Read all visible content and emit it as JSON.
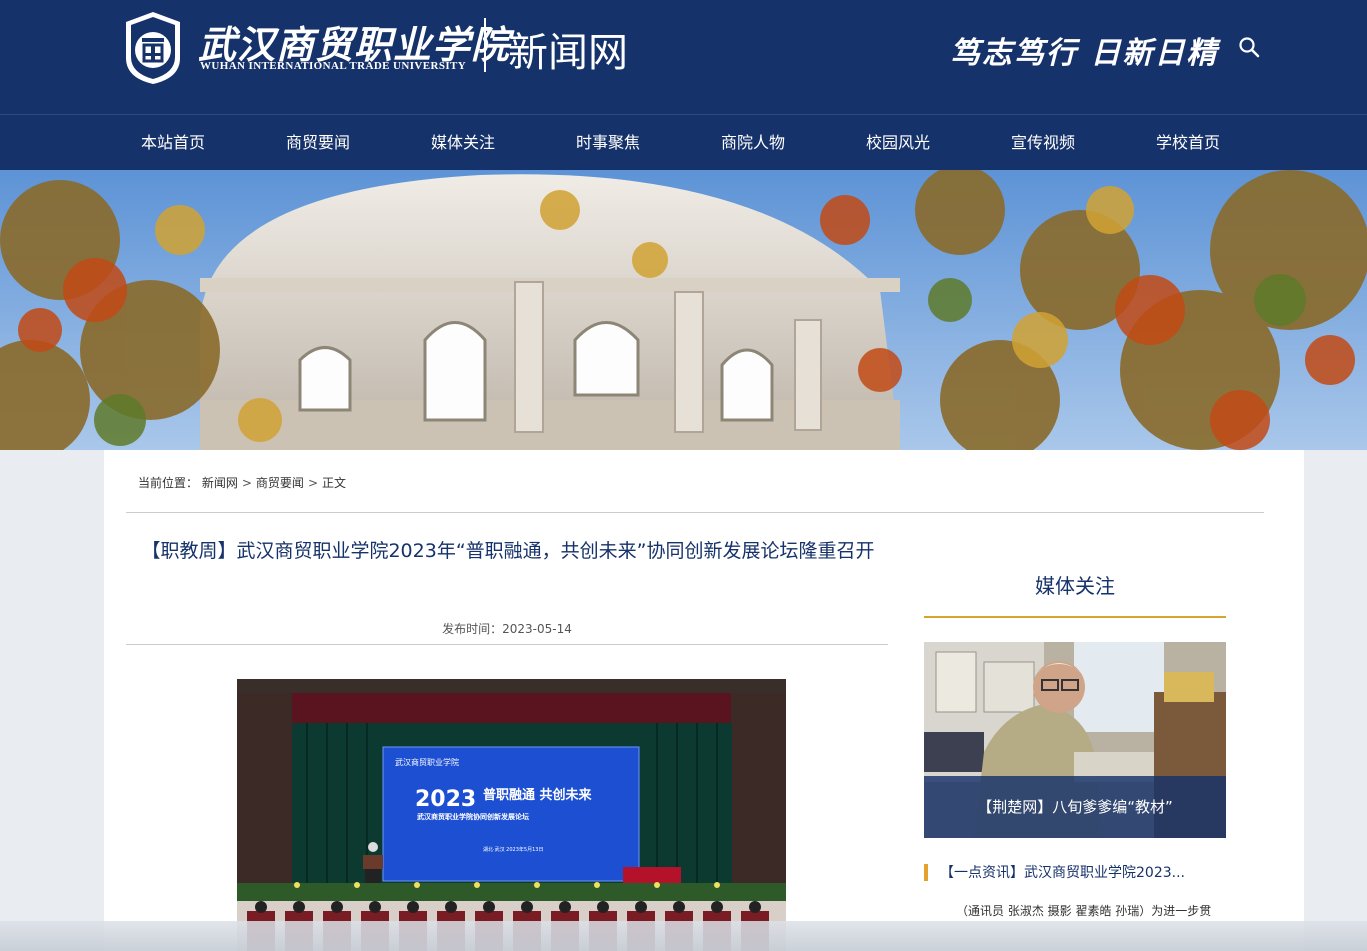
{
  "header": {
    "school_name_cn": "武汉商贸职业学院",
    "school_name_en": "WUHAN INTERNATIONAL TRADE UNIVERSITY",
    "site_name": "新闻网",
    "motto": "笃志笃行 日新日精",
    "search_icon": "search-icon",
    "brand_color": "#16326a"
  },
  "nav": {
    "items": [
      {
        "label": "本站首页"
      },
      {
        "label": "商贸要闻"
      },
      {
        "label": "媒体关注"
      },
      {
        "label": "时事聚焦"
      },
      {
        "label": "商院人物"
      },
      {
        "label": "校园风光"
      },
      {
        "label": "宣传视频"
      },
      {
        "label": "学校首页"
      }
    ]
  },
  "breadcrumb": {
    "prefix": "当前位置：",
    "items": [
      "新闻网",
      "商贸要闻",
      "正文"
    ],
    "separator": ">"
  },
  "article": {
    "title": "【职教周】武汉商贸职业学院2023年“普职融通，共创未来”协同创新发展论坛隆重召开",
    "date_label": "发布时间：",
    "date": "2023-05-14",
    "photo": {
      "screen_school": "武汉商贸职业学院",
      "screen_year": "2023",
      "screen_slogan": "普职融通 共创未来",
      "screen_subtitle": "武汉商贸职业学院协同创新发展论坛",
      "screen_date": "湖北·武汉 2023年5月13日"
    }
  },
  "sidebar": {
    "title": "媒体关注",
    "card_caption": "【荆楚网】八旬爹爹编“教材”",
    "list_item": "【一点资讯】武汉商贸职业学院2023...",
    "snippet": "（通讯员 张淑杰 摄影 翟素皓 孙瑞）为进一步贯",
    "accent_color": "#d6a52a"
  }
}
